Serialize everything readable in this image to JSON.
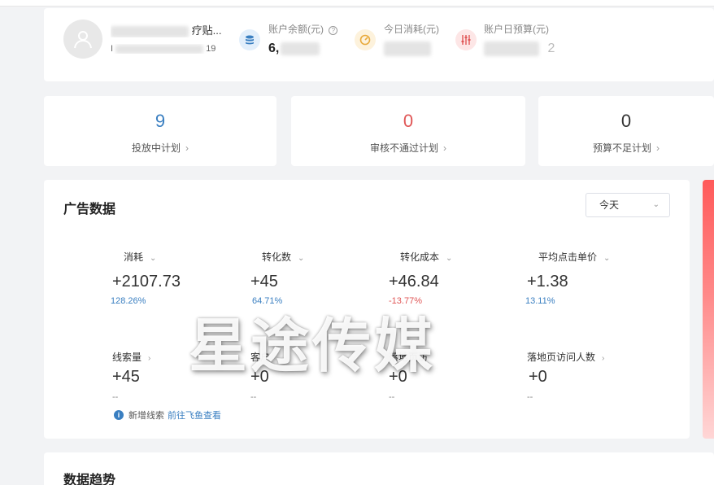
{
  "account": {
    "name": "疗贴...",
    "id_prefix": "I",
    "id_suffix": "19",
    "balance_label": "账户余额(元)",
    "balance_value": "6,",
    "today_spend_label": "今日消耗(元)",
    "daily_budget_label": "账户日预算(元)",
    "daily_budget_suffix": "2"
  },
  "summary": [
    {
      "value": "9",
      "label": "投放中计划",
      "color": "#3a7fc1"
    },
    {
      "value": "0",
      "label": "审核不通过计划",
      "color": "#e05656"
    },
    {
      "value": "0",
      "label": "预算不足计划",
      "color": "#333333"
    }
  ],
  "ad_data": {
    "title": "广告数据",
    "range": "今天",
    "metrics_row1": [
      {
        "label": "消耗",
        "value": "+2107.73",
        "pct": "128.26%",
        "trend": "up"
      },
      {
        "label": "转化数",
        "value": "+45",
        "pct": "64.71%",
        "trend": "up"
      },
      {
        "label": "转化成本",
        "value": "+46.84",
        "pct": "-13.77%",
        "trend": "down"
      },
      {
        "label": "平均点击单价",
        "value": "+1.38",
        "pct": "13.11%",
        "trend": "up"
      }
    ],
    "metrics_row2": [
      {
        "label": "线索量",
        "value": "+45",
        "dash": "--"
      },
      {
        "label": "客户",
        "value": "+0",
        "dash": "--"
      },
      {
        "label": "落地页访",
        "value": "+0",
        "dash": "--"
      },
      {
        "label": "落地页访问人数",
        "value": "+0",
        "dash": "--"
      }
    ],
    "info_text": "新增线索",
    "info_link": "前往飞鱼查看"
  },
  "trend": {
    "title": "数据趋势"
  },
  "watermark": "星途传媒",
  "colors": {
    "accent": "#3a7fc1",
    "negative": "#e05656"
  }
}
